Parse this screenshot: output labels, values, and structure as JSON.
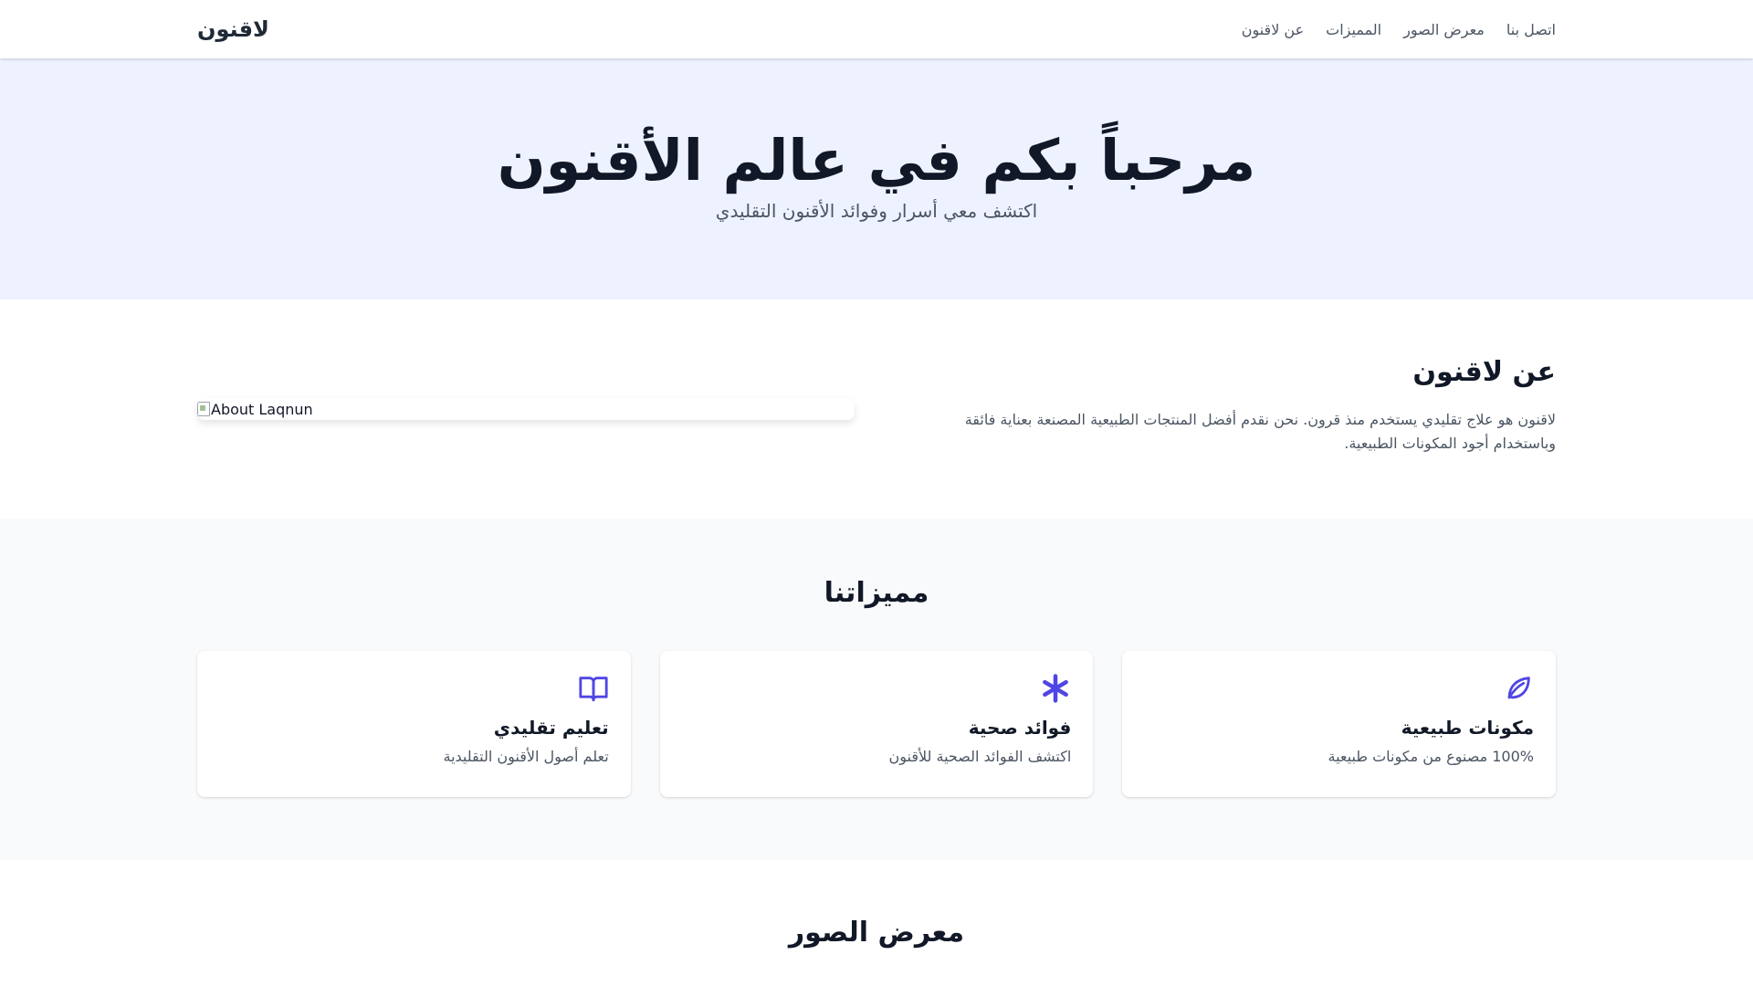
{
  "nav": {
    "logo": "لاقنون",
    "links": [
      "اتصل بنا",
      "معرض الصور",
      "المميزات",
      "عن لاقنون"
    ]
  },
  "hero": {
    "title": "مرحباً بكم في عالم الأقنون",
    "subtitle": "اكتشف معي أسرار وفوائد الأقنون التقليدي"
  },
  "about": {
    "title": "عن لاقنون",
    "description": "لاقنون هو علاج تقليدي يستخدم منذ قرون. نحن نقدم أفضل المنتجات الطبيعية المصنعة بعناية فائقة وباستخدام أجود المكونات الطبيعية.",
    "image_alt": "About Laqnun"
  },
  "features": {
    "title": "مميزاتنا",
    "items": [
      {
        "icon": "leaf-icon",
        "title": "مكونات طبيعية",
        "description": "100% مصنوع من مكونات طبيعية"
      },
      {
        "icon": "asterisk-icon",
        "title": "فوائد صحية",
        "description": "اكتشف الفوائد الصحية للأقنون"
      },
      {
        "icon": "book-open-icon",
        "title": "تعليم تقليدي",
        "description": "تعلم أصول الأقنون التقليدية"
      }
    ]
  },
  "gallery": {
    "title": "معرض الصور"
  },
  "colors": {
    "accent": "#4f46e5",
    "hero_bg": "#eef2ff",
    "features_bg": "#f9fafb",
    "text_muted": "#4b5563"
  }
}
